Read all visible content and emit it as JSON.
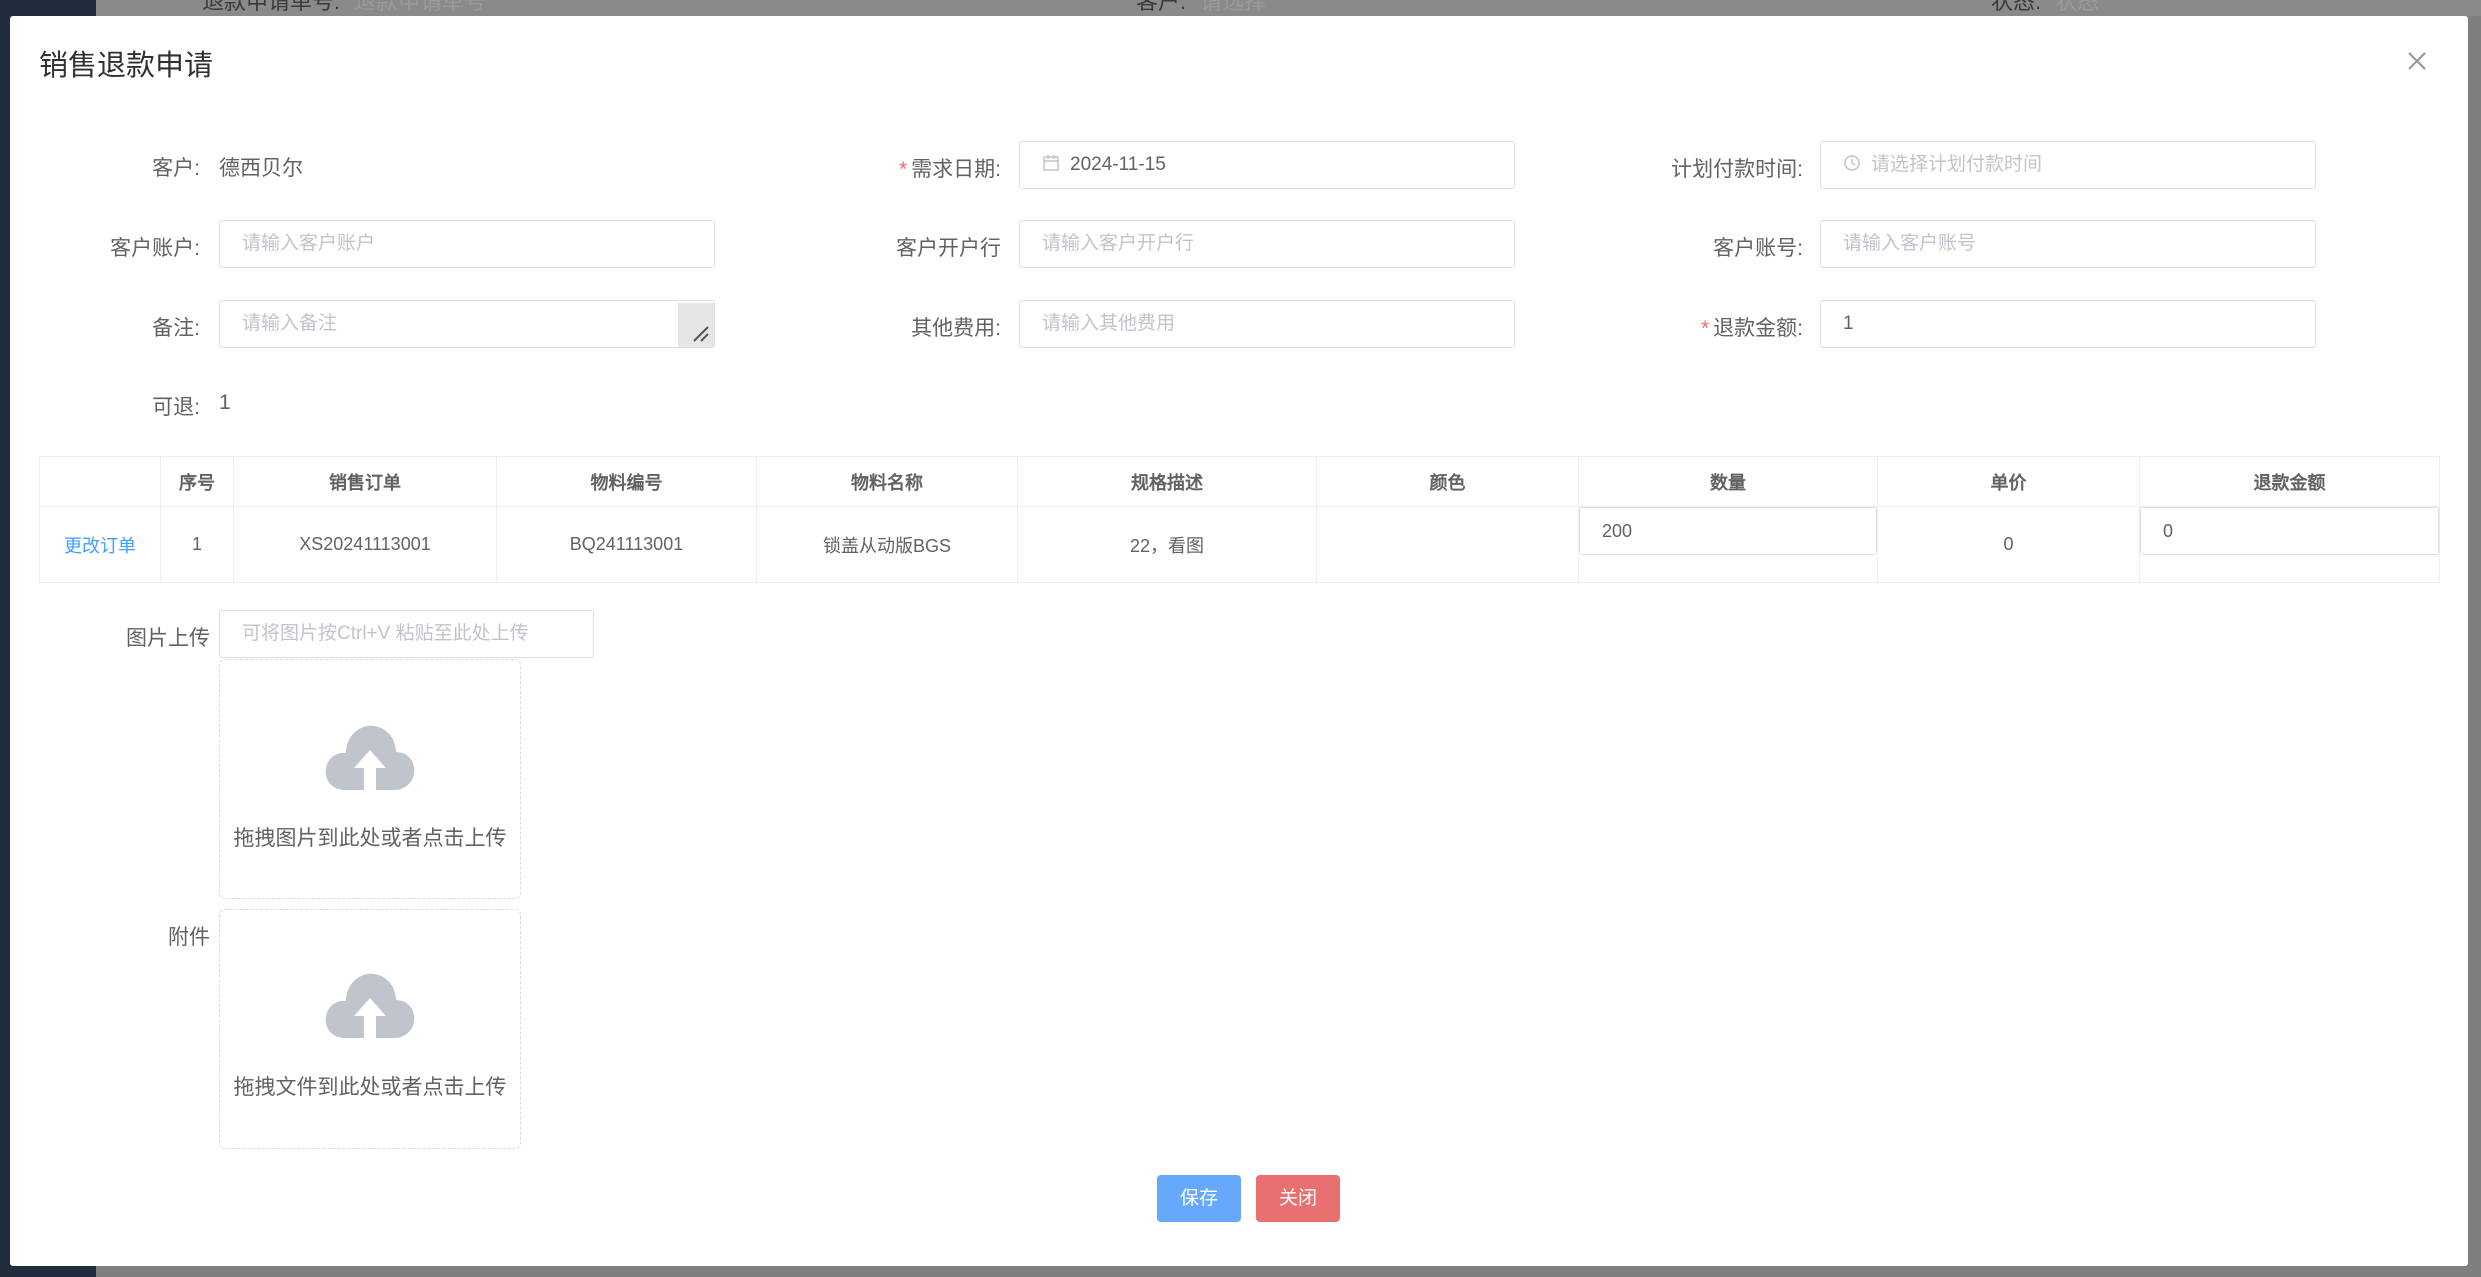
{
  "background": {
    "filters": [
      {
        "label": "退款申请单号:",
        "placeholder": "退款申请单号"
      },
      {
        "label": "客户:",
        "placeholder": "请选择"
      },
      {
        "label": "状态:",
        "placeholder": "状态"
      }
    ]
  },
  "dialog": {
    "title": "销售退款申请"
  },
  "form": {
    "customer": {
      "label": "客户:",
      "value": "德西贝尔"
    },
    "demand_date": {
      "label": "需求日期:",
      "value": "2024-11-15"
    },
    "plan_pay_time": {
      "label": "计划付款时间:",
      "placeholder": "请选择计划付款时间"
    },
    "customer_account": {
      "label": "客户账户:",
      "placeholder": "请输入客户账户"
    },
    "customer_bank": {
      "label": "客户开户行",
      "placeholder": "请输入客户开户行"
    },
    "customer_account_no": {
      "label": "客户账号:",
      "placeholder": "请输入客户账号"
    },
    "remark": {
      "label": "备注:",
      "placeholder": "请输入备注"
    },
    "other_fee": {
      "label": "其他费用:",
      "placeholder": "请输入其他费用"
    },
    "refund_amount": {
      "label": "退款金额:",
      "value": "1"
    },
    "refundable": {
      "label": "可退:",
      "value": "1"
    }
  },
  "table": {
    "headers": [
      "",
      "序号",
      "销售订单",
      "物料编号",
      "物料名称",
      "规格描述",
      "颜色",
      "数量",
      "单价",
      "退款金额"
    ],
    "rows": [
      {
        "action": "更改订单",
        "index": "1",
        "order": "XS20241113001",
        "material_no": "BQ241113001",
        "material_name": "锁盖从动版BGS",
        "spec": "22，看图",
        "color": "",
        "qty": "200",
        "price": "0",
        "refund": "0"
      }
    ]
  },
  "image_upload": {
    "label": "图片上传",
    "paste_placeholder": "可将图片按Ctrl+V 粘贴至此处上传",
    "drop_text": "拖拽图片到此处或者点击上传"
  },
  "attachment": {
    "label": "附件",
    "drop_text": "拖拽文件到此处或者点击上传"
  },
  "buttons": {
    "save": "保存",
    "close": "关闭"
  },
  "colors": {
    "primary": "#409eff",
    "required": "#f56c6c",
    "save_button": "#66a9fb",
    "close_button": "#e87070"
  }
}
